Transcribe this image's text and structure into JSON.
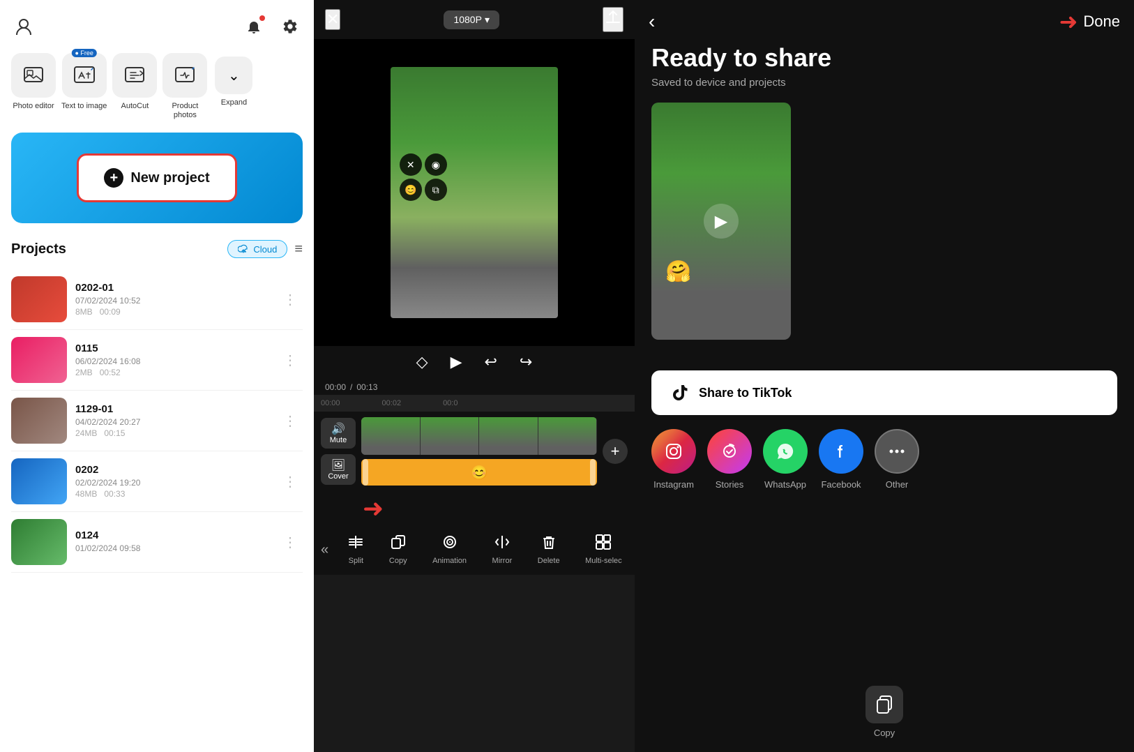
{
  "left": {
    "tools": [
      {
        "id": "photo-editor",
        "icon": "⊞",
        "label": "Photo editor"
      },
      {
        "id": "text-to-image",
        "icon": "🖼",
        "label": "Text to image",
        "badge": "Free"
      },
      {
        "id": "autocut",
        "icon": "⚡",
        "label": "AutoCut"
      },
      {
        "id": "product-photos",
        "icon": "✦",
        "label": "Product photos"
      },
      {
        "id": "expand",
        "icon": "⌄",
        "label": "Expand"
      }
    ],
    "new_project_label": "New project",
    "projects_title": "Projects",
    "cloud_label": "Cloud",
    "projects": [
      {
        "id": "0202-01",
        "name": "0202-01",
        "date": "07/02/2024 10:52",
        "size": "8MB",
        "duration": "00:09",
        "color": "thumb-red"
      },
      {
        "id": "0115",
        "name": "0115",
        "date": "06/02/2024 16:08",
        "size": "2MB",
        "duration": "00:52",
        "color": "thumb-pink"
      },
      {
        "id": "1129-01",
        "name": "1129-01",
        "date": "04/02/2024 20:27",
        "size": "24MB",
        "duration": "00:15",
        "color": "thumb-brown"
      },
      {
        "id": "0202",
        "name": "0202",
        "date": "02/02/2024 19:20",
        "size": "48MB",
        "duration": "00:33",
        "color": "thumb-blue"
      },
      {
        "id": "0124",
        "name": "0124",
        "date": "01/02/2024 09:58",
        "color": "thumb-green"
      }
    ]
  },
  "editor": {
    "resolution": "1080P",
    "current_time": "00:00",
    "total_time": "00:13",
    "timeline_markers": [
      "00:00",
      "00:02",
      "00:0"
    ],
    "track_controls": [
      {
        "icon": "🔊",
        "label": "Mute"
      },
      {
        "icon": "🖼",
        "label": "Cover"
      }
    ],
    "toolbar_tools": [
      {
        "icon": "⍏",
        "label": "Split"
      },
      {
        "icon": "⧉",
        "label": "Copy"
      },
      {
        "icon": "◎",
        "label": "Animation"
      },
      {
        "icon": "⟺",
        "label": "Mirror"
      },
      {
        "icon": "🗑",
        "label": "Delete"
      },
      {
        "icon": "⊞",
        "label": "Multi-selec"
      }
    ]
  },
  "share": {
    "title": "Ready to share",
    "subtitle": "Saved to device and projects",
    "done_label": "Done",
    "tiktok_btn_label": "Share to TikTok",
    "share_options": [
      {
        "id": "instagram",
        "label": "Instagram",
        "color": "#e91e63"
      },
      {
        "id": "stories",
        "label": "Stories",
        "color": "#e040fb"
      },
      {
        "id": "whatsapp",
        "label": "WhatsApp",
        "color": "#25d366"
      },
      {
        "id": "facebook",
        "label": "Facebook",
        "color": "#1877f2"
      },
      {
        "id": "other",
        "label": "Other",
        "color": "#555"
      }
    ],
    "copy_label": "Copy"
  }
}
